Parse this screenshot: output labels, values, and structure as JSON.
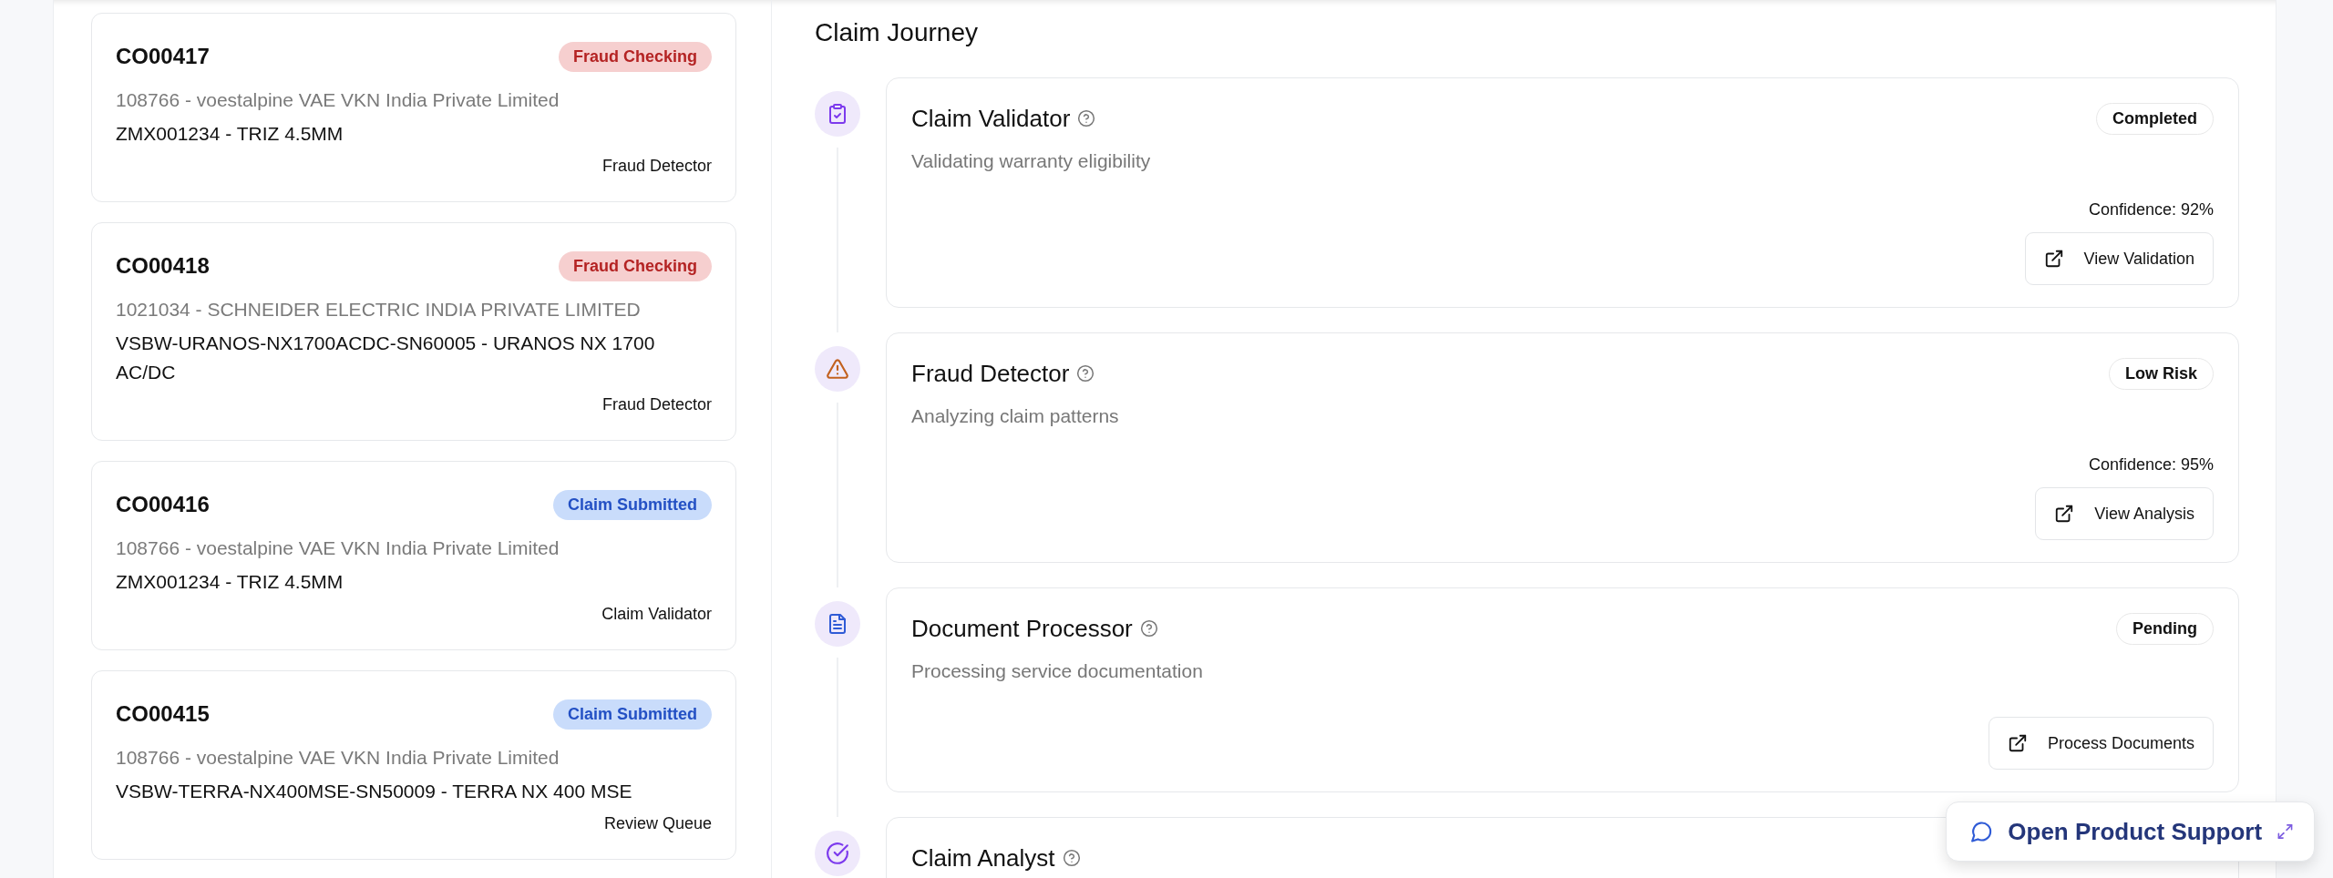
{
  "claims": [
    {
      "id": "CO00417",
      "status": {
        "label": "Fraud Checking",
        "kind": "fraud"
      },
      "customer": "108766 - voestalpine VAE VKN India Private Limited",
      "product": "ZMX001234 - TRIZ 4.5MM",
      "stage": "Fraud Detector"
    },
    {
      "id": "CO00418",
      "status": {
        "label": "Fraud Checking",
        "kind": "fraud"
      },
      "customer": "1021034 - SCHNEIDER ELECTRIC INDIA PRIVATE LIMITED",
      "product": "VSBW-URANOS-NX1700ACDC-SN60005 - URANOS NX 1700 AC/DC",
      "stage": "Fraud Detector"
    },
    {
      "id": "CO00416",
      "status": {
        "label": "Claim Submitted",
        "kind": "submitted"
      },
      "customer": "108766 - voestalpine VAE VKN India Private Limited",
      "product": "ZMX001234 - TRIZ 4.5MM",
      "stage": "Claim Validator"
    },
    {
      "id": "CO00415",
      "status": {
        "label": "Claim Submitted",
        "kind": "submitted"
      },
      "customer": "108766 - voestalpine VAE VKN India Private Limited",
      "product": "VSBW-TERRA-NX400MSE-SN50009 - TERRA NX 400 MSE",
      "stage": "Review Queue"
    }
  ],
  "journey": {
    "title": "Claim Journey",
    "steps": [
      {
        "kind": "clipboard",
        "title": "Claim Validator",
        "badge": "Completed",
        "description": "Validating warranty eligibility",
        "confidence": "Confidence: 92%",
        "action": "View Validation"
      },
      {
        "kind": "warning",
        "title": "Fraud Detector",
        "badge": "Low Risk",
        "description": "Analyzing claim patterns",
        "confidence": "Confidence: 95%",
        "action": "View Analysis"
      },
      {
        "kind": "document",
        "title": "Document Processor",
        "badge": "Pending",
        "description": "Processing service documentation",
        "action": "Process Documents"
      },
      {
        "kind": "check",
        "title": "Claim Analyst"
      }
    ]
  },
  "support_button": {
    "label": "Open Product Support"
  }
}
